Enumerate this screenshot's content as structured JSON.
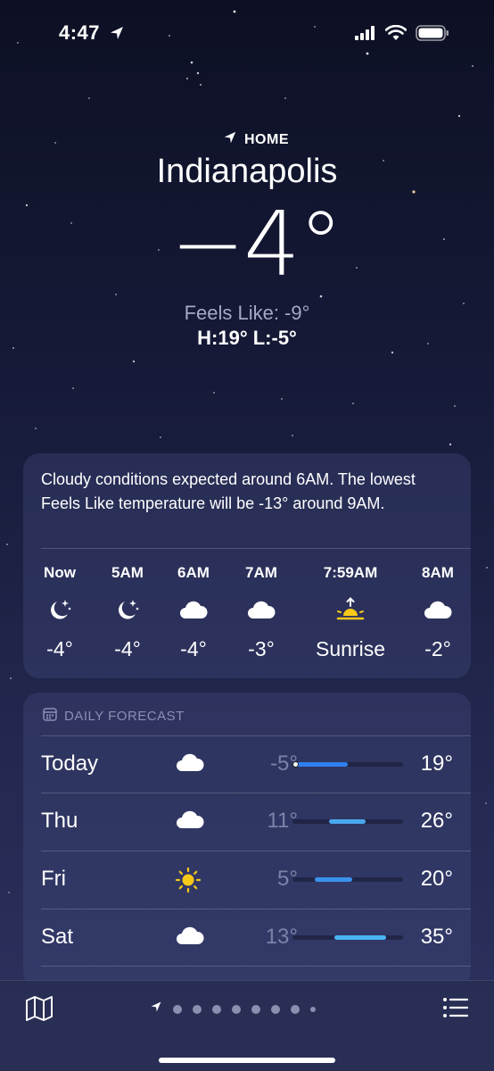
{
  "status_bar": {
    "time": "4:47"
  },
  "header": {
    "home_label": "HOME",
    "city": "Indianapolis",
    "temperature": "−4°",
    "feels_like": "Feels Like: -9°",
    "high_low": "H:19°  L:-5°"
  },
  "hourly": {
    "summary": "Cloudy conditions expected around 6AM. The lowest Feels Like temperature will be -13° around 9AM.",
    "hours": [
      {
        "time": "Now",
        "icon": "moon-stars-icon",
        "temp": "-4°"
      },
      {
        "time": "5AM",
        "icon": "moon-stars-icon",
        "temp": "-4°"
      },
      {
        "time": "6AM",
        "icon": "cloud-icon",
        "temp": "-4°"
      },
      {
        "time": "7AM",
        "icon": "cloud-icon",
        "temp": "-3°"
      },
      {
        "time": "7:59AM",
        "icon": "sunrise-icon",
        "temp": "Sunrise"
      },
      {
        "time": "8AM",
        "icon": "cloud-icon",
        "temp": "-2°"
      }
    ]
  },
  "daily": {
    "heading": "DAILY FORECAST",
    "days": [
      {
        "name": "Today",
        "icon": "cloud-icon",
        "low": "-5°",
        "high": "19°",
        "bar_start": 0.0,
        "bar_end": 0.5,
        "current_marker": 0.02,
        "bar_color": "#2f7ff0"
      },
      {
        "name": "Thu",
        "icon": "cloud-icon",
        "low": "11°",
        "high": "26°",
        "bar_start": 0.33,
        "bar_end": 0.66,
        "bar_color": "#4aa8ef"
      },
      {
        "name": "Fri",
        "icon": "sun-icon",
        "low": "5°",
        "high": "20°",
        "bar_start": 0.2,
        "bar_end": 0.54,
        "bar_color": "#3b92ee"
      },
      {
        "name": "Sat",
        "icon": "cloud-icon",
        "low": "13°",
        "high": "35°",
        "bar_start": 0.38,
        "bar_end": 0.85,
        "bar_color": "#4ab3f2"
      }
    ]
  },
  "bottom_bar": {
    "page_count": 9,
    "map_icon": "map-icon",
    "list_icon": "list-icon"
  },
  "colors": {
    "background_top": "#0d1024",
    "background_bottom": "#2d3360",
    "secondary_text": "#a4a8c8",
    "sun": "#f6c818"
  }
}
